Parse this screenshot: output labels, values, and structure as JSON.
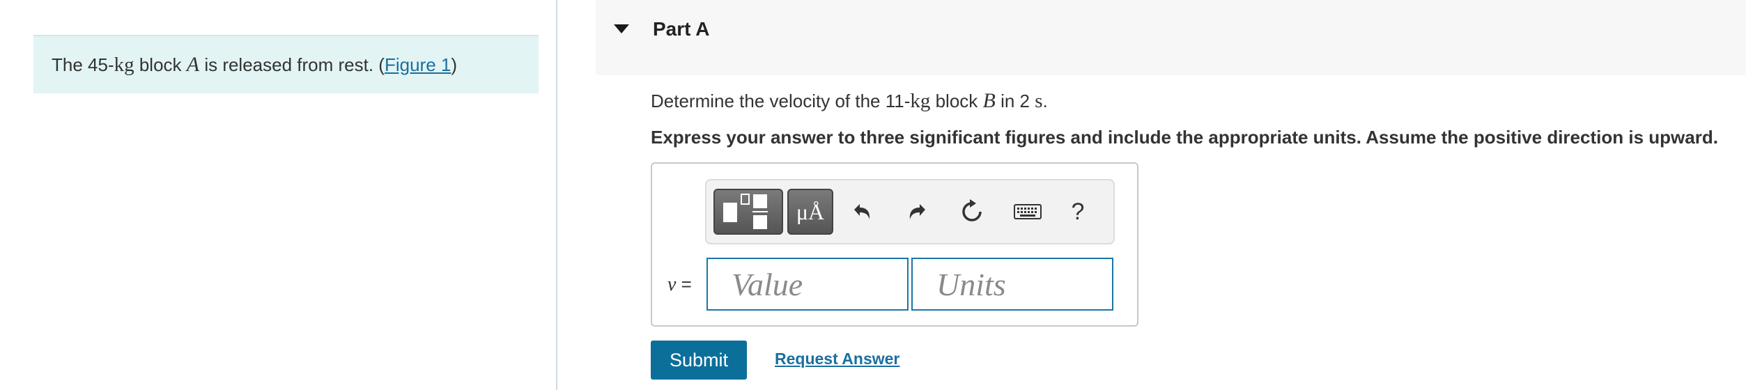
{
  "problem": {
    "text_before": "The 45-",
    "unit_kg": "kg",
    "text_mid": " block ",
    "var_a": "A",
    "text_after": " is released from rest. (",
    "figure_link": "Figure 1",
    "close_paren": ")"
  },
  "part": {
    "title": "Part A"
  },
  "question": {
    "text_before": "Determine the velocity of the 11-",
    "unit_kg": "kg",
    "text_mid": " block ",
    "var_b": "B",
    "text_in": " in 2 ",
    "unit_s": "s",
    "text_end": "."
  },
  "instruction": "Express your answer to three significant figures and include the appropriate units. Assume the positive direction is upward.",
  "toolbar": {
    "units_label": "μÅ",
    "help_label": "?",
    "icons": [
      "templates-icon",
      "units-icon",
      "undo-icon",
      "redo-icon",
      "reset-icon",
      "keyboard-icon",
      "help-icon"
    ]
  },
  "answer": {
    "var_label": "v",
    "equals": " =",
    "value_placeholder": "Value",
    "units_placeholder": "Units",
    "value": "",
    "units": ""
  },
  "actions": {
    "submit_label": "Submit",
    "request_label": "Request Answer"
  },
  "colors": {
    "accent": "#0c6f9a",
    "link": "#1a6fa0",
    "problem_bg": "#e3f4f4",
    "header_bg": "#f7f7f7"
  }
}
